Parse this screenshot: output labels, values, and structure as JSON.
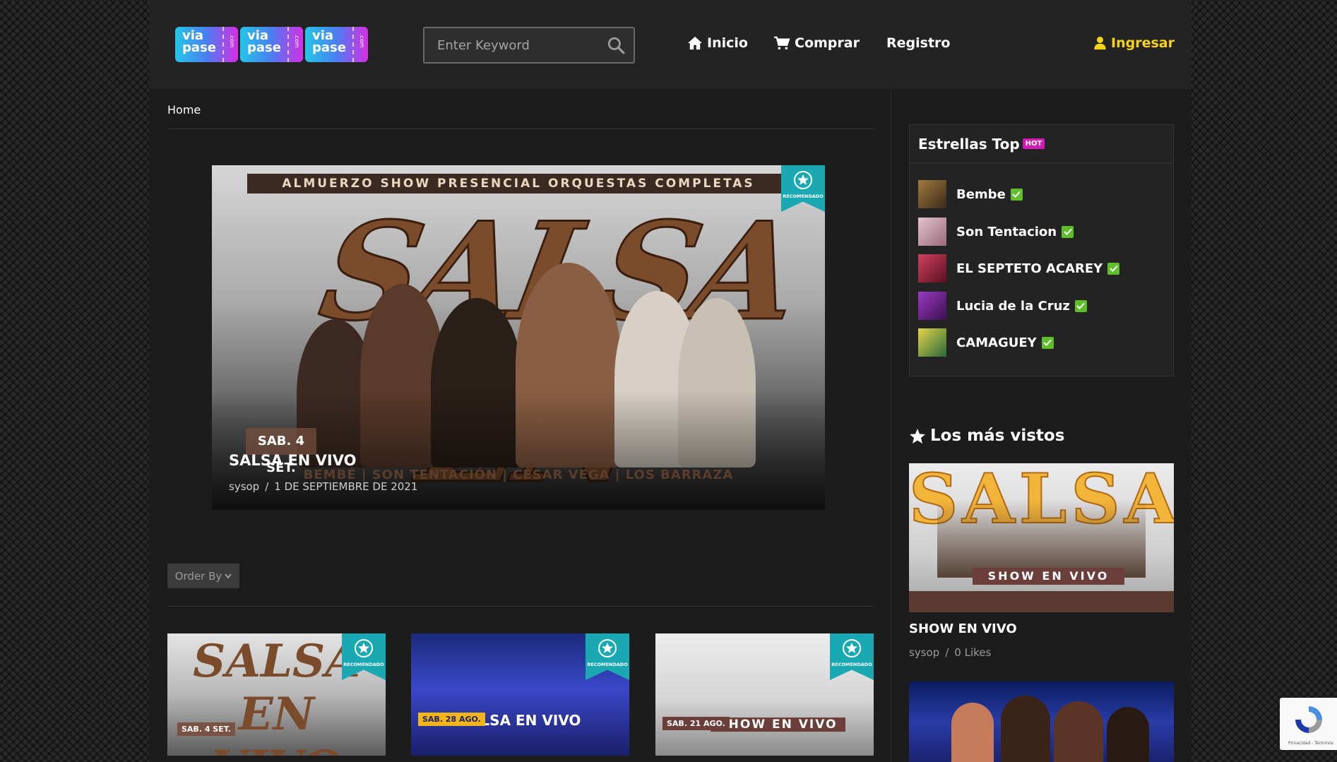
{
  "header": {
    "logo": {
      "ticket_text": "via pase",
      "ticket_side": ".com",
      "ticket_count": 3
    },
    "search": {
      "placeholder": "Enter Keyword",
      "value": ""
    },
    "nav": {
      "inicio": "Inicio",
      "comprar": "Comprar",
      "registro": "Registro",
      "ingresar": "Ingresar"
    }
  },
  "breadcrumb": {
    "home": "Home"
  },
  "hero": {
    "poster_banner": "ALMUERZO SHOW PRESENCIAL ORQUESTAS COMPLETAS",
    "poster_big": "SALSA EN VIVO",
    "poster_date": "SAB. 4 SET.",
    "poster_foot": "BEMBÉ | SON TENTACIÓN | CÉSAR VEGA | LOS BARRAZA",
    "badge": "RECOMENDADO",
    "title": "SALSA EN VIVO",
    "author": "sysop",
    "date": "1 DE SEPTIEMBRE DE 2021"
  },
  "order_by": {
    "label": "Order By"
  },
  "thumbnails": [
    {
      "title": "SALSA EN VIVO",
      "badge": "RECOMENDADO",
      "date": "SAB. 4 SET.",
      "theme": "light"
    },
    {
      "title": "SALSA EN VIVO",
      "badge": "RECOMENDADO",
      "date": "SAB. 28 AGO.",
      "theme": "blue"
    },
    {
      "title": "SHOW EN VIVO",
      "badge": "RECOMENDADO",
      "date": "SAB. 21 AGO.",
      "theme": "light"
    }
  ],
  "sidebar": {
    "stars_title": "Estrellas Top",
    "hot_label": "HOT",
    "stars": [
      {
        "name": "Bembe",
        "avatar_color": "#7a5a30"
      },
      {
        "name": "Son Tentacion",
        "avatar_color": "#c99aa8"
      },
      {
        "name": "EL SEPTETO ACAREY",
        "avatar_color": "#b03050"
      },
      {
        "name": "Lucia de la Cruz",
        "avatar_color": "#6a2a8a"
      },
      {
        "name": "CAMAGUEY",
        "avatar_color": "#4a8a3a"
      }
    ],
    "most_viewed_title": "Los más vistos",
    "most_viewed": [
      {
        "title": "SHOW EN VIVO",
        "author": "sysop",
        "likes": "0 Likes",
        "poster_big": "SALSA",
        "poster_sub": "SHOW EN VIVO"
      }
    ]
  },
  "recaptcha": {
    "text": "Privacidad - Términos"
  },
  "colors": {
    "accent_yellow": "#f6d316",
    "hot_magenta": "#d21ab6",
    "verified_green": "#5fbf2b",
    "ribbon_teal": "#1aa9b3"
  }
}
